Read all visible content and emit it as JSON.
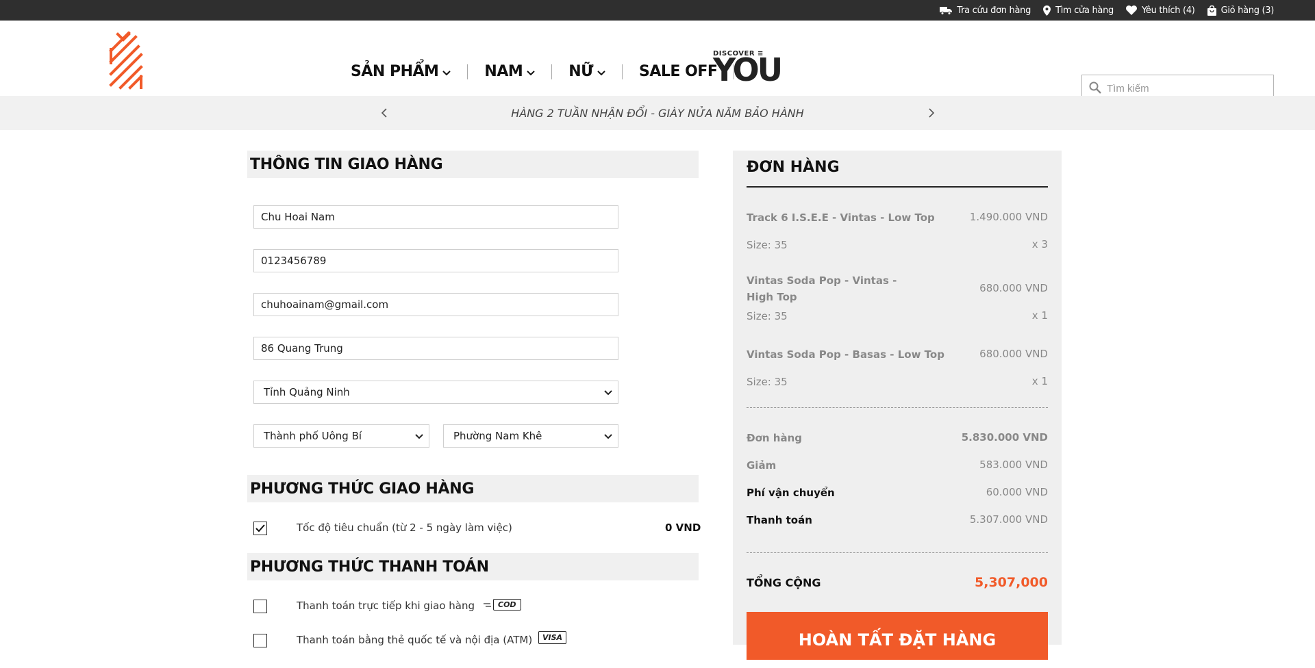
{
  "topbar": {
    "track_order": "Tra cứu đơn hàng",
    "find_store": "Tìm cửa hàng",
    "wishlist": "Yêu thích (4)",
    "cart": "Giỏ hàng (3)"
  },
  "nav": {
    "products": "SẢN PHẨM",
    "men": "NAM",
    "women": "NỮ",
    "sale": "SALE OFF",
    "discover_small": "DISCOVER",
    "discover_big": "YOU"
  },
  "search": {
    "placeholder": "Tìm kiếm"
  },
  "banner": {
    "message": "HÀNG 2 TUẦN NHẬN ĐỔI - GIÀY NỬA NĂM BẢO HÀNH"
  },
  "shipping_info": {
    "title": "THÔNG TIN GIAO HÀNG",
    "name": "Chu Hoai Nam",
    "phone": "0123456789",
    "email": "chuhoainam@gmail.com",
    "address": "86 Quang Trung",
    "province": "Tỉnh Quảng Ninh",
    "district": "Thành phố Uông Bí",
    "ward": "Phường Nam Khê"
  },
  "shipping_method": {
    "title": "PHƯƠNG THỨC GIAO HÀNG",
    "option": "Tốc độ tiêu chuẩn (từ 2 - 5 ngày làm việc)",
    "price": "0 VND",
    "checked": true
  },
  "payment_method": {
    "title": "PHƯƠNG THỨC THANH TOÁN",
    "cod_label": "Thanh toán trực tiếp khi giao hàng",
    "cod_badge": "COD",
    "card_label": "Thanh toán bằng thẻ quốc tế và nội địa (ATM)",
    "card_badge": "VISA"
  },
  "order": {
    "title": "ĐƠN HÀNG",
    "items": [
      {
        "name": "Track 6 I.S.E.E - Vintas - Low Top",
        "price": "1.490.000 VND",
        "size": "Size: 35",
        "qty": "x 3"
      },
      {
        "name": "Vintas Soda Pop - Vintas - High Top",
        "price": "680.000 VND",
        "size": "Size: 35",
        "qty": "x 1"
      },
      {
        "name": "Vintas Soda Pop - Basas - Low Top",
        "price": "680.000 VND",
        "size": "Size: 35",
        "qty": "x 1"
      }
    ],
    "subtotal_label": "Đơn hàng",
    "subtotal": "5.830.000 VND",
    "discount_label": "Giảm",
    "discount": "583.000 VND",
    "shipping_label": "Phí vận chuyển",
    "shipping": "60.000 VND",
    "payment_label": "Thanh toán",
    "payment": "5.307.000 VND",
    "total_label": "TỔNG CỘNG",
    "total": "5,307,000",
    "submit": "HOÀN TẤT ĐẶT HÀNG"
  },
  "colors": {
    "accent": "#f15a29",
    "topbar": "#2f2f2f"
  }
}
